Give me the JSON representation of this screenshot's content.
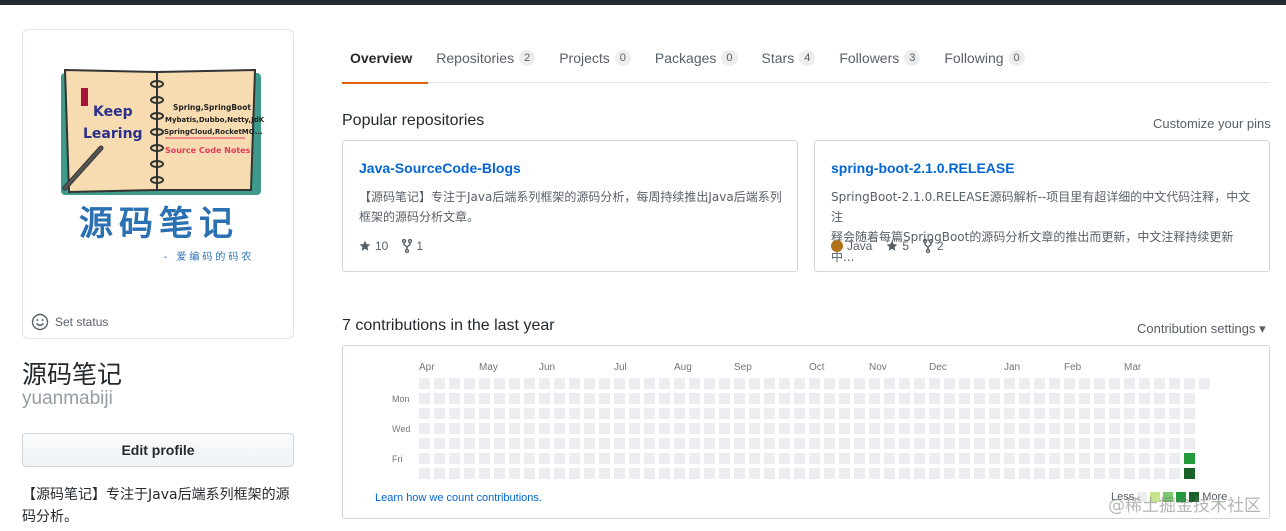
{
  "avatar": {
    "notebook_text": [
      "Spring,SpringBoot",
      "Mybatis,Dubbo,Netty,JdK",
      "SpringCloud,RocketMQ..."
    ],
    "notebook_left": [
      "Keep",
      "Learing"
    ],
    "notebook_red": "Source Code Notes",
    "big_text": "源码笔记",
    "tagline": "- 爱编码的码农"
  },
  "status": {
    "label": "Set status",
    "icon": "smiley-icon"
  },
  "profile": {
    "name": "源码笔记",
    "login": "yuanmabiji",
    "edit_label": "Edit profile",
    "bio": "【源码笔记】专注于Java后端系列框架的源码分析。"
  },
  "tabs": [
    {
      "label": "Overview",
      "count": null,
      "selected": true
    },
    {
      "label": "Repositories",
      "count": "2"
    },
    {
      "label": "Projects",
      "count": "0"
    },
    {
      "label": "Packages",
      "count": "0"
    },
    {
      "label": "Stars",
      "count": "4"
    },
    {
      "label": "Followers",
      "count": "3"
    },
    {
      "label": "Following",
      "count": "0"
    }
  ],
  "popular": {
    "title": "Popular repositories",
    "customize_label": "Customize your pins",
    "repos": [
      {
        "name": "Java-SourceCode-Blogs",
        "desc_lines": [
          "【源码笔记】专注于Java后端系列框架的源码分析，每周持续推出Java后端系列",
          "框架的源码分析文章。"
        ],
        "language": null,
        "stars": "10",
        "forks": "1"
      },
      {
        "name": "spring-boot-2.1.0.RELEASE",
        "desc_lines": [
          "SpringBoot-2.1.0.RELEASE源码解析--项目里有超详细的中文代码注释，中文注",
          "释会随着每篇SpringBoot的源码分析文章的推出而更新，中文注释持续更新中..."
        ],
        "language": "Java",
        "language_color": "#b07219",
        "stars": "5",
        "forks": "2"
      }
    ]
  },
  "contributions": {
    "title": "7 contributions in the last year",
    "settings_label": "Contribution settings ▾",
    "months": [
      "Apr",
      "May",
      "Jun",
      "Jul",
      "Aug",
      "Sep",
      "Oct",
      "Nov",
      "Dec",
      "Jan",
      "Feb",
      "Mar"
    ],
    "days": [
      "Mon",
      "Wed",
      "Fri"
    ],
    "learn_label": "Learn how we count contributions.",
    "legend_less": "Less",
    "legend_more": "More",
    "colors": {
      "empty": "#ebedf0",
      "l1": "#c6e48b",
      "l2": "#7bc96f",
      "l3": "#239a3b",
      "l4": "#196127"
    },
    "active_cells": [
      {
        "week": 51,
        "day": 5,
        "level": 3
      },
      {
        "week": 51,
        "day": 6,
        "level": 4
      }
    ]
  },
  "watermark": "@稀土掘金技术社区"
}
